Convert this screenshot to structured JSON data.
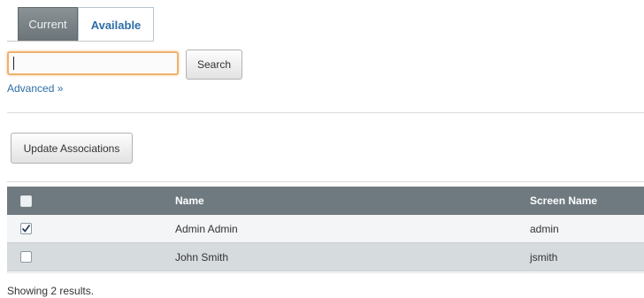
{
  "tabs": [
    {
      "label": "Current",
      "active": false
    },
    {
      "label": "Available",
      "active": true
    }
  ],
  "search": {
    "value": "",
    "placeholder": "",
    "button_label": "Search"
  },
  "advanced_link": "Advanced »",
  "update_button_label": "Update Associations",
  "table": {
    "columns": [
      "",
      "Name",
      "Screen Name"
    ],
    "rows": [
      {
        "checked": true,
        "name": "Admin Admin",
        "screen_name": "admin"
      },
      {
        "checked": false,
        "name": "John Smith",
        "screen_name": "jsmith"
      }
    ]
  },
  "status_text": "Showing 2 results.",
  "colors": {
    "header_bg": "#6f7a80",
    "link": "#2d6ea8",
    "focus_border": "#f0b16e"
  }
}
